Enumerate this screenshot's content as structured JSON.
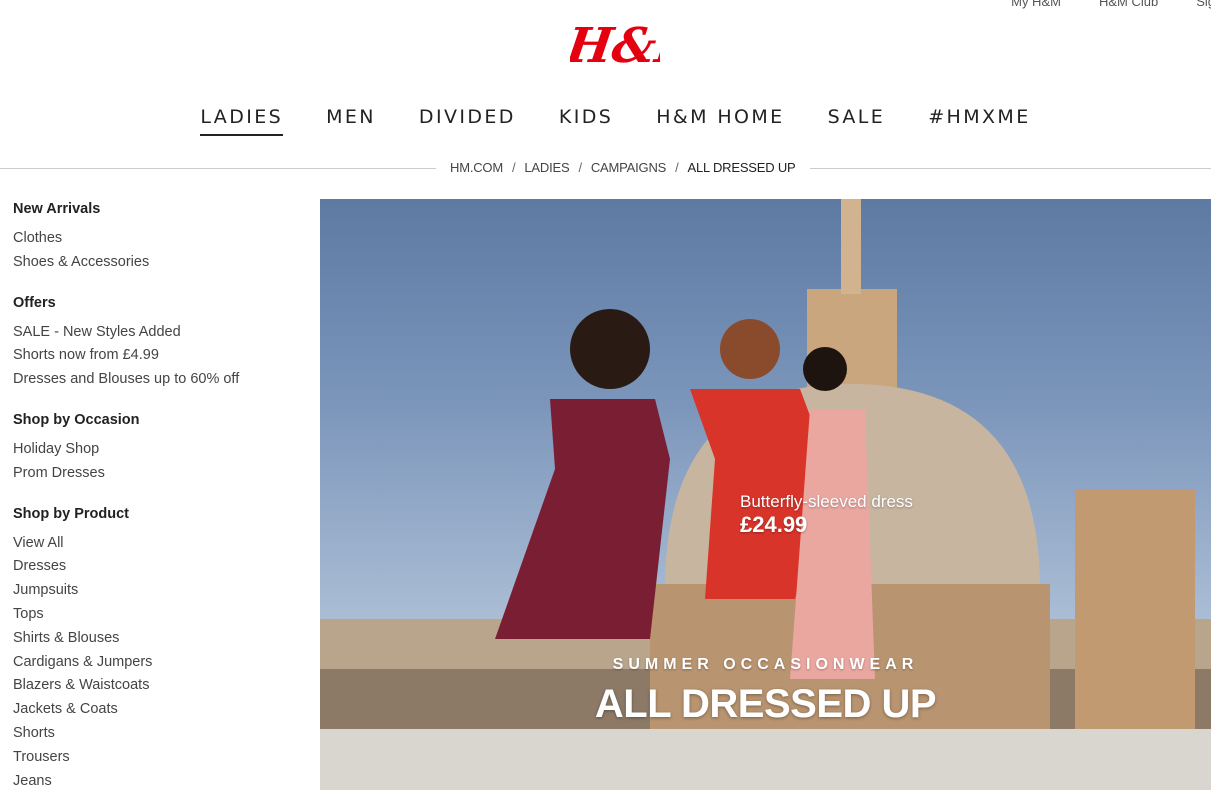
{
  "top_links": [
    "My H&M",
    "H&M Club",
    "Sig"
  ],
  "logo_text": "H&M",
  "brand_color": "#e50010",
  "nav": [
    {
      "label": "LADIES",
      "active": true
    },
    {
      "label": "MEN"
    },
    {
      "label": "DIVIDED"
    },
    {
      "label": "KIDS"
    },
    {
      "label": "H&M HOME"
    },
    {
      "label": "SALE"
    },
    {
      "label": "#HMXME"
    }
  ],
  "breadcrumb": [
    "HM.COM",
    "LADIES",
    "CAMPAIGNS",
    "ALL DRESSED UP"
  ],
  "breadcrumb_separator": "/",
  "sidebar": [
    {
      "heading": "New Arrivals",
      "items": [
        "Clothes",
        "Shoes & Accessories"
      ]
    },
    {
      "heading": "Offers",
      "items": [
        "SALE - New Styles Added",
        "Shorts now from £4.99",
        "Dresses and Blouses up to 60% off"
      ]
    },
    {
      "heading": "Shop by Occasion",
      "items": [
        "Holiday Shop",
        "Prom Dresses"
      ]
    },
    {
      "heading": "Shop by Product",
      "items": [
        "View All",
        "Dresses",
        "Jumpsuits",
        "Tops",
        "Shirts & Blouses",
        "Cardigans & Jumpers",
        "Blazers & Waistcoats",
        "Jackets & Coats",
        "Shorts",
        "Trousers",
        "Jeans"
      ]
    }
  ],
  "hero": {
    "product_name": "Butterfly-sleeved dress",
    "product_price": "£24.99",
    "kicker": "SUMMER OCCASIONWEAR",
    "title": "ALL DRESSED UP"
  }
}
